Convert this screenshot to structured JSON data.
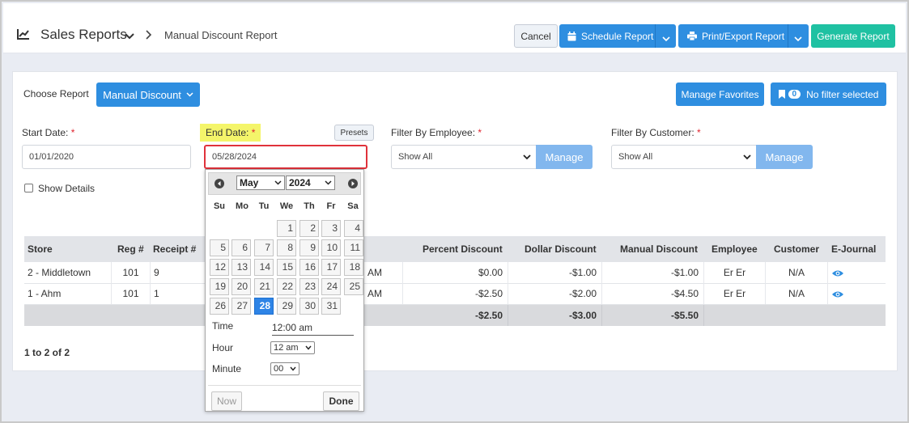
{
  "header": {
    "title": "Sales Reports",
    "subtitle": "Manual Discount Report",
    "cancel_label": "Cancel",
    "schedule_label": "Schedule Report",
    "print_label": "Print/Export Report",
    "generate_label": "Generate Report"
  },
  "panel": {
    "choose_report_label": "Choose Report",
    "report_type": "Manual Discount",
    "manage_favorites_label": "Manage Favorites",
    "filter_count": "0",
    "filter_label": "No filter selected",
    "start_date_label": "Start Date:",
    "start_date_value": "01/01/2020",
    "end_date_label": "End Date:",
    "end_date_value": "05/28/2024",
    "presets_label": "Presets",
    "filter_employee_label": "Filter By Employee:",
    "filter_employee_value": "Show All",
    "filter_customer_label": "Filter By Customer:",
    "filter_customer_value": "Show All",
    "manage_label": "Manage",
    "show_details_label": "Show Details",
    "required_mark": "*"
  },
  "table": {
    "columns": [
      "Store",
      "Reg #",
      "Receipt #",
      "Percent Discount",
      "Dollar Discount",
      "Manual Discount",
      "Employee",
      "Customer",
      "E-Journal"
    ],
    "rows": [
      {
        "store": "2 - Middletown",
        "reg": "101",
        "receipt": "9",
        "time_suffix": "AM",
        "percent": "$0.00",
        "dollar": "-$1.00",
        "manual": "-$1.00",
        "employee": "Er Er",
        "customer": "N/A"
      },
      {
        "store": "1 - Ahm",
        "reg": "101",
        "receipt": "1",
        "time_suffix": "AM",
        "percent": "-$2.50",
        "dollar": "-$2.00",
        "manual": "-$4.50",
        "employee": "Er Er",
        "customer": "N/A"
      }
    ],
    "totals": {
      "percent": "-$2.50",
      "dollar": "-$3.00",
      "manual": "-$5.50"
    },
    "pagination": "1 to 2 of 2"
  },
  "datepicker": {
    "month": "May",
    "year": "2024",
    "weekdays": [
      "Su",
      "Mo",
      "Tu",
      "We",
      "Th",
      "Fr",
      "Sa"
    ],
    "selected_day": "28",
    "time_label": "Time",
    "time_value": "12:00 am",
    "hour_label": "Hour",
    "hour_value": "12 am",
    "minute_label": "Minute",
    "minute_value": "00",
    "now_label": "Now",
    "done_label": "Done"
  },
  "colors": {
    "primary": "#2e8ee0",
    "green": "#1fc1a2",
    "manage": "#82b7ee",
    "highlight": "#f4f56a",
    "required": "#e0242f",
    "selected_day": "#2e84e6"
  }
}
